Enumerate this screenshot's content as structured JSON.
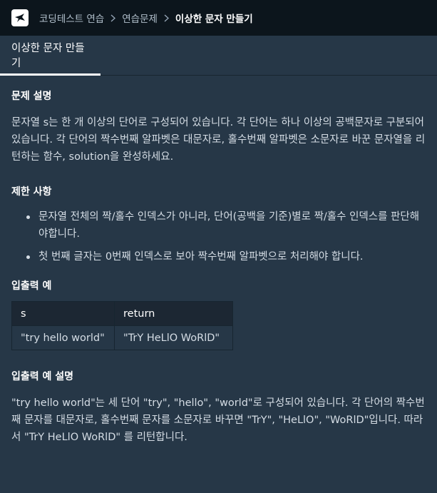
{
  "header": {
    "breadcrumb": [
      "코딩테스트 연습",
      "연습문제",
      "이상한 문자 만들기"
    ]
  },
  "tab": {
    "label": "이상한 문자 만들기"
  },
  "description": {
    "heading": "문제 설명",
    "text": "문자열 s는 한 개 이상의 단어로 구성되어 있습니다. 각 단어는 하나 이상의 공백문자로 구분되어 있습니다. 각 단어의 짝수번째 알파벳은 대문자로, 홀수번째 알파벳은 소문자로 바꾼 문자열을 리턴하는 함수, solution을 완성하세요."
  },
  "constraints": {
    "heading": "제한 사항",
    "items": [
      "문자열 전체의 짝/홀수 인덱스가 아니라, 단어(공백을 기준)별로 짝/홀수 인덱스를 판단해야합니다.",
      "첫 번째 글자는 0번째 인덱스로 보아 짝수번째 알파벳으로 처리해야 합니다."
    ]
  },
  "examples": {
    "heading": "입출력 예",
    "headers": [
      "s",
      "return"
    ],
    "rows": [
      [
        "\"try hello world\"",
        "\"TrY HeLlO WoRlD\""
      ]
    ]
  },
  "explanation": {
    "heading": "입출력 예 설명",
    "text": "\"try hello world\"는 세 단어 \"try\", \"hello\", \"world\"로 구성되어 있습니다. 각 단어의 짝수번째 문자를 대문자로, 홀수번째 문자를 소문자로 바꾸면 \"TrY\", \"HeLlO\", \"WoRlD\"입니다. 따라서 \"TrY HeLlO WoRlD\" 를 리턴합니다."
  },
  "colors": {
    "background": "#263747",
    "topbar": "#0c151c",
    "table_header": "#1c2733"
  }
}
